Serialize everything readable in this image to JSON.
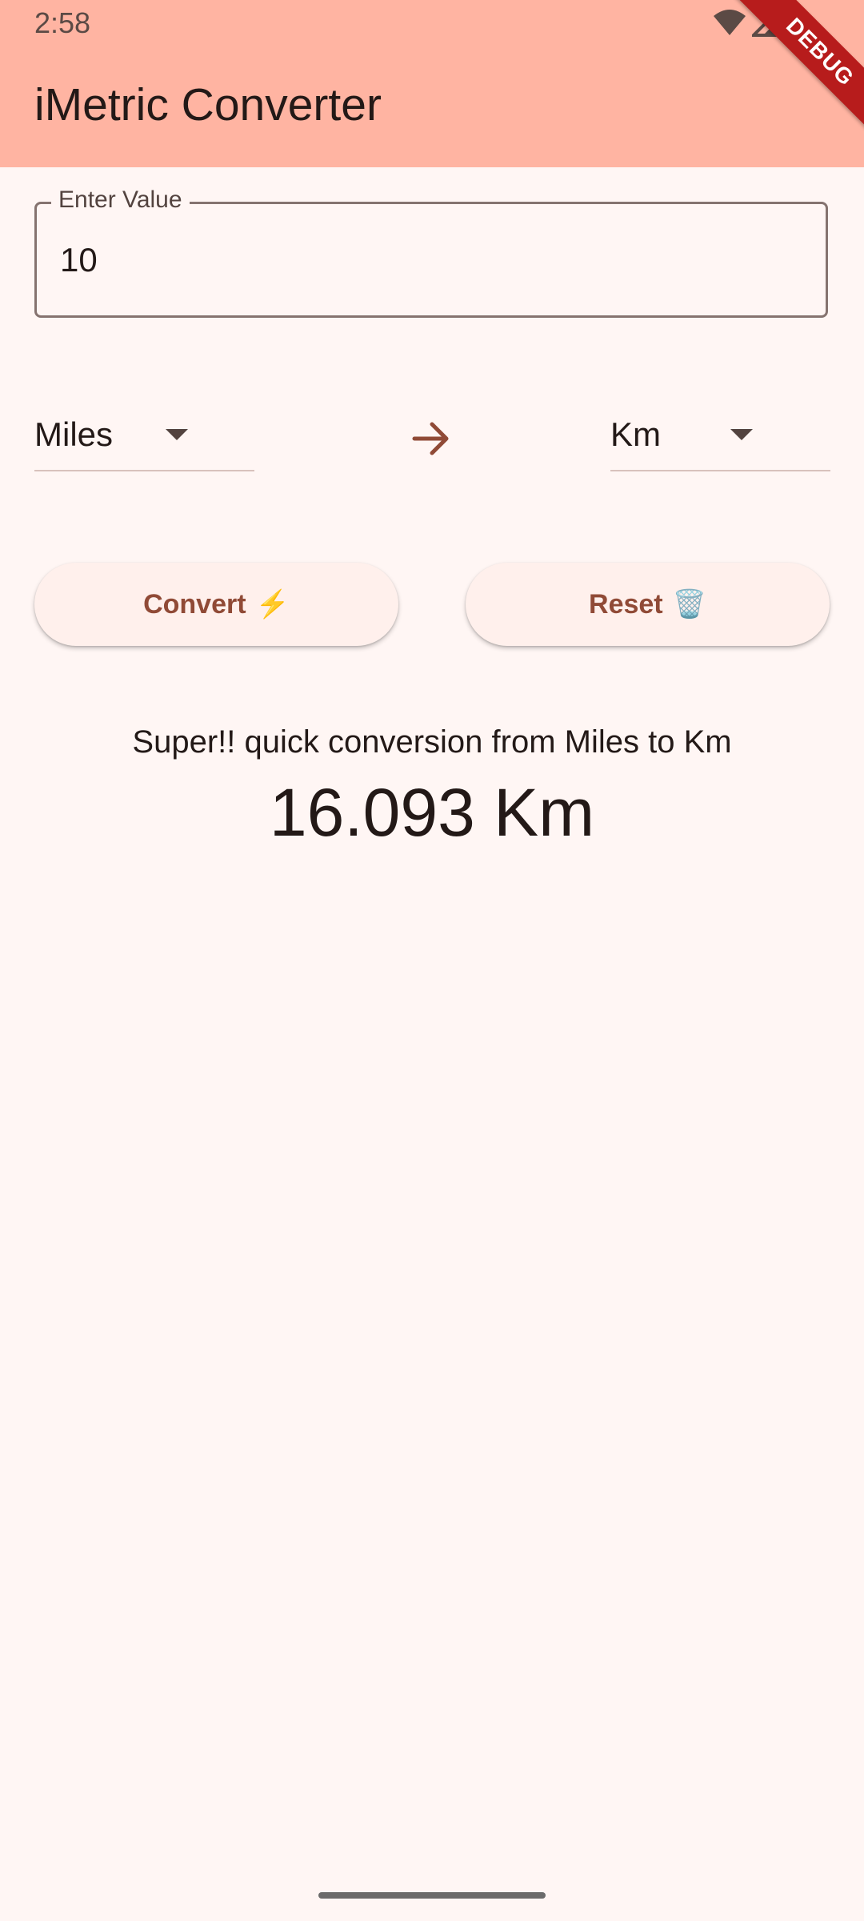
{
  "status_bar": {
    "time": "2:58",
    "icons": [
      "wifi-icon",
      "signal-icon",
      "battery-icon"
    ]
  },
  "app_bar": {
    "title": "iMetric Converter",
    "debug_banner": "DEBUG"
  },
  "input": {
    "label": "Enter Value",
    "value": "10"
  },
  "conversion": {
    "from_unit": "Miles",
    "to_unit": "Km",
    "arrow_icon": "arrow-right-icon"
  },
  "buttons": {
    "convert_label": "Convert",
    "convert_emoji": "⚡",
    "reset_label": "Reset",
    "reset_emoji": "🗑️"
  },
  "result": {
    "caption": "Super!! quick conversion from Miles to Km",
    "value": "16.093 Km"
  },
  "colors": {
    "app_bar": "#FFB4A2",
    "background": "#FFF6F4",
    "accent": "#904A36",
    "button_bg": "#FFF0EC",
    "debug_banner": "#B71C1C"
  }
}
